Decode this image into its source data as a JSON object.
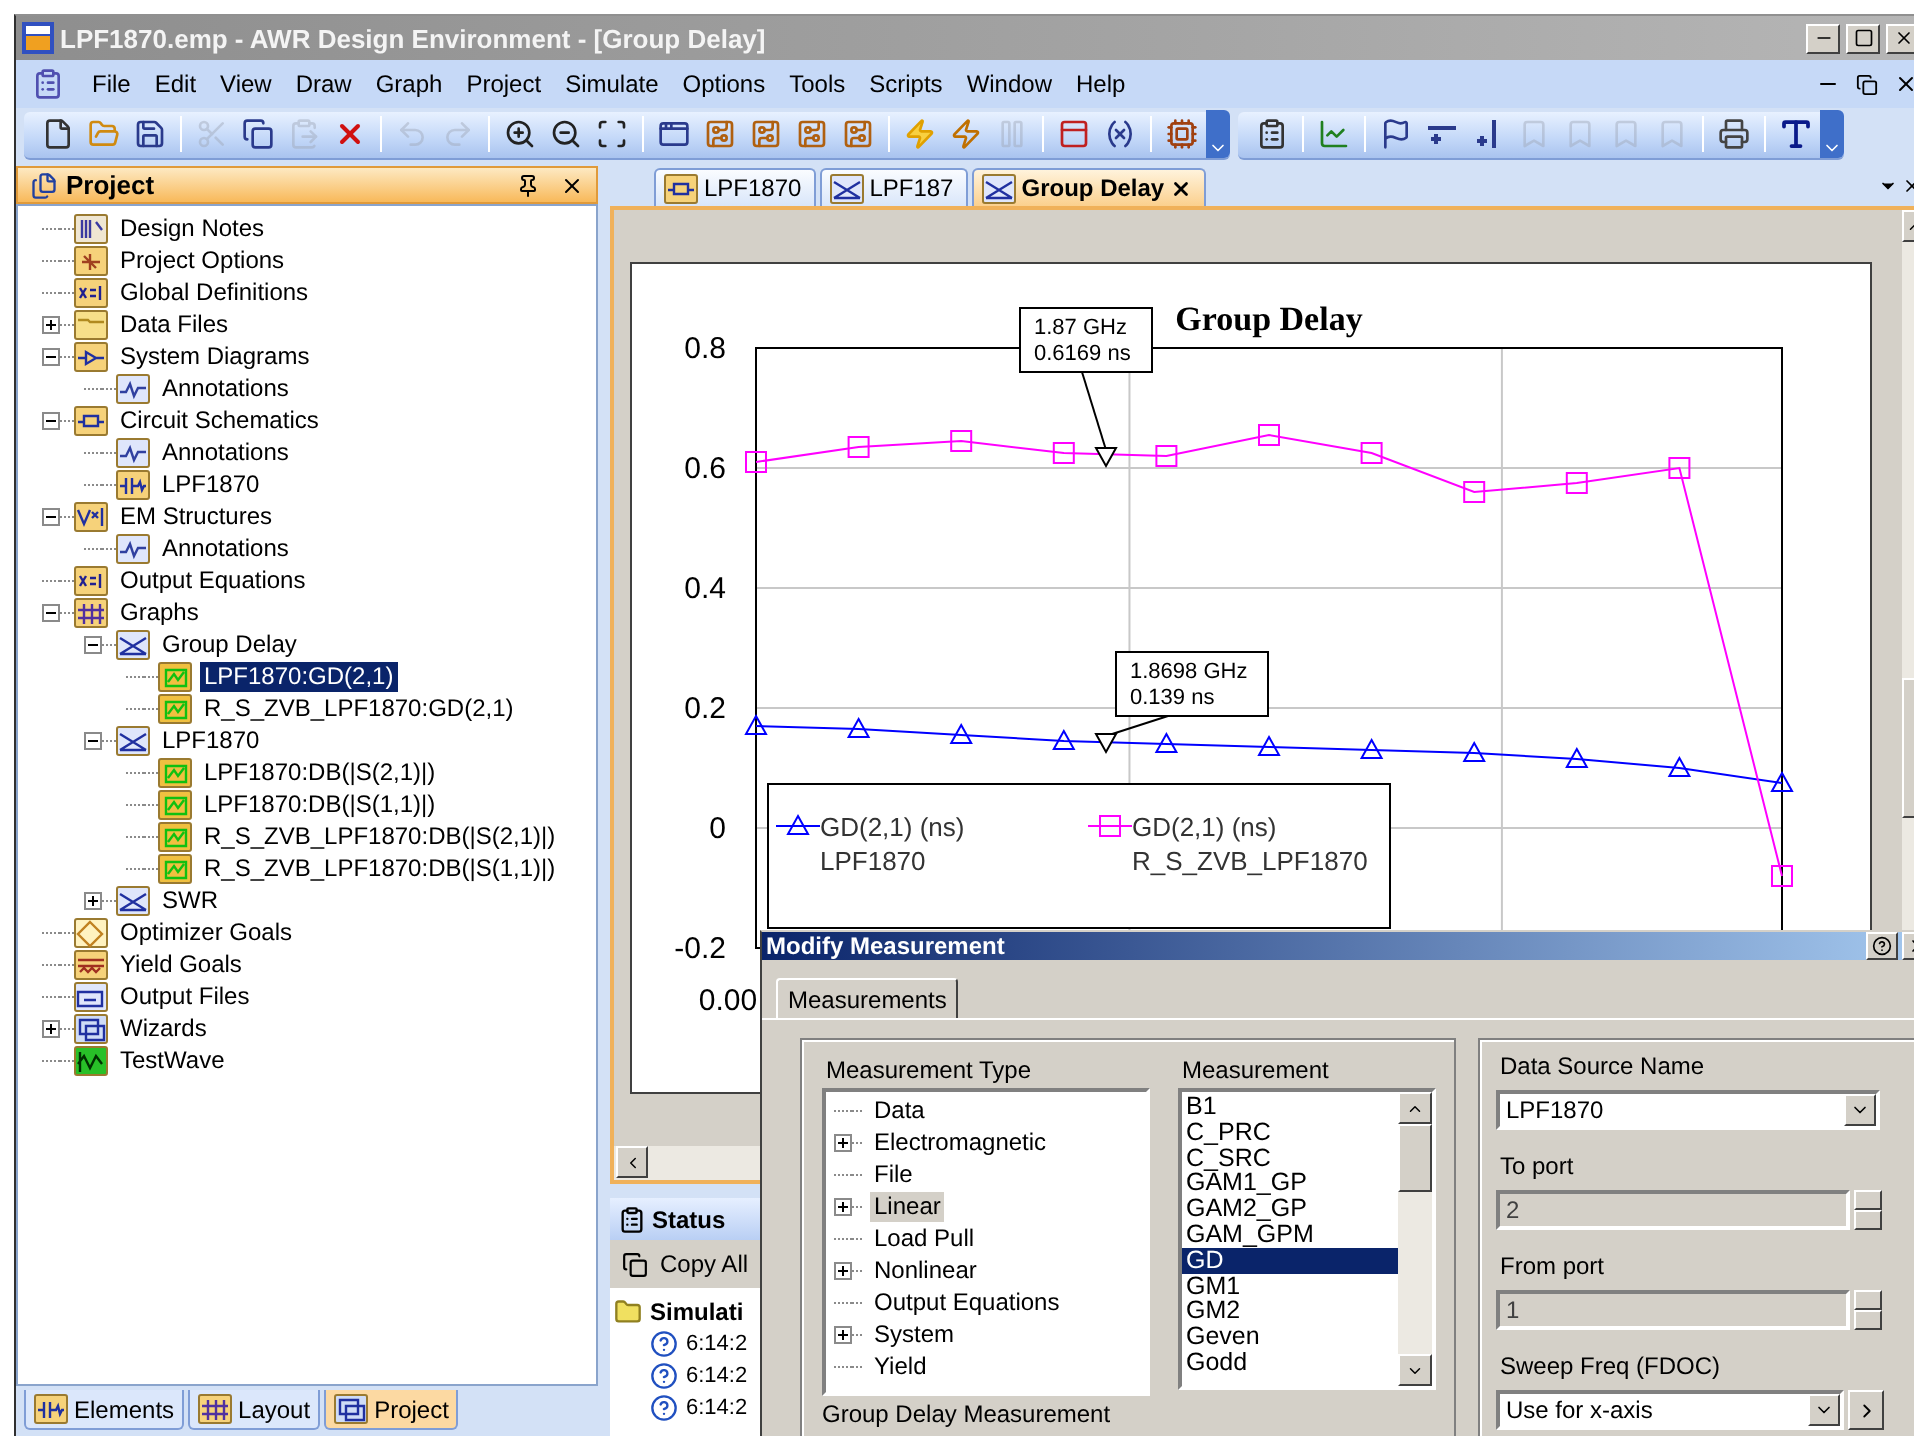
{
  "window": {
    "title": "LPF1870.emp - AWR Design Environment - [Group Delay]"
  },
  "menu": [
    "File",
    "Edit",
    "View",
    "Draw",
    "Graph",
    "Project",
    "Simulate",
    "Options",
    "Tools",
    "Scripts",
    "Window",
    "Help"
  ],
  "toolbars": [
    [
      {
        "kind": "new",
        "disabled": false
      },
      {
        "kind": "open",
        "disabled": false
      },
      {
        "kind": "save",
        "disabled": false
      },
      {
        "kind": "separator"
      },
      {
        "kind": "cut",
        "disabled": true
      },
      {
        "kind": "copy",
        "disabled": false
      },
      {
        "kind": "paste",
        "disabled": true
      },
      {
        "kind": "delete",
        "disabled": false
      },
      {
        "kind": "separator"
      },
      {
        "kind": "undo",
        "disabled": true
      },
      {
        "kind": "redo",
        "disabled": true
      },
      {
        "kind": "separator"
      },
      {
        "kind": "zoom-in",
        "disabled": false
      },
      {
        "kind": "zoom-out",
        "disabled": false
      },
      {
        "kind": "zoom-fit",
        "disabled": false
      },
      {
        "kind": "separator"
      },
      {
        "kind": "new-window",
        "disabled": false
      },
      {
        "kind": "board",
        "disabled": false
      },
      {
        "kind": "board",
        "disabled": false
      },
      {
        "kind": "board",
        "disabled": false
      },
      {
        "kind": "board",
        "disabled": false
      },
      {
        "kind": "separator"
      },
      {
        "kind": "lightning",
        "disabled": false
      },
      {
        "kind": "tune",
        "disabled": false
      },
      {
        "kind": "pause",
        "disabled": true
      },
      {
        "kind": "separator"
      },
      {
        "kind": "panel",
        "disabled": false
      },
      {
        "kind": "variable",
        "disabled": false
      },
      {
        "kind": "separator"
      },
      {
        "kind": "chip",
        "disabled": false
      },
      {
        "kind": "overflow"
      }
    ],
    [
      {
        "kind": "properties",
        "disabled": false
      },
      {
        "kind": "separator"
      },
      {
        "kind": "chart",
        "disabled": false
      },
      {
        "kind": "separator"
      },
      {
        "kind": "marker",
        "disabled": false
      },
      {
        "kind": "hline",
        "disabled": false
      },
      {
        "kind": "vline",
        "disabled": false
      },
      {
        "kind": "marker-max",
        "disabled": true
      },
      {
        "kind": "marker-min",
        "disabled": true
      },
      {
        "kind": "marker-query",
        "disabled": true
      },
      {
        "kind": "marker-ref",
        "disabled": true
      },
      {
        "kind": "separator"
      },
      {
        "kind": "printer",
        "disabled": false
      },
      {
        "kind": "separator"
      },
      {
        "kind": "text",
        "disabled": false
      },
      {
        "kind": "overflow"
      }
    ]
  ],
  "project_panel": {
    "title": "Project",
    "tree": [
      {
        "label": "Design Notes",
        "kind": "notes",
        "selected": false
      },
      {
        "label": "Project Options",
        "kind": "options",
        "selected": false
      },
      {
        "label": "Global Definitions",
        "kind": "definitions",
        "selected": false
      },
      {
        "label": "Data Files",
        "kind": "folder",
        "expanded": false,
        "selected": false
      },
      {
        "label": "System Diagrams",
        "kind": "diagram",
        "expanded": true,
        "selected": false,
        "children": [
          {
            "label": "Annotations",
            "kind": "annotation",
            "selected": false
          }
        ]
      },
      {
        "label": "Circuit Schematics",
        "kind": "schematic",
        "expanded": true,
        "selected": false,
        "children": [
          {
            "label": "Annotations",
            "kind": "annotation",
            "selected": false
          },
          {
            "label": "LPF1870",
            "kind": "circuit",
            "selected": false
          }
        ]
      },
      {
        "label": "EM Structures",
        "kind": "em",
        "expanded": true,
        "selected": false,
        "children": [
          {
            "label": "Annotations",
            "kind": "annotation",
            "selected": false
          }
        ]
      },
      {
        "label": "Output Equations",
        "kind": "definitions",
        "selected": false
      },
      {
        "label": "Graphs",
        "kind": "grid",
        "expanded": true,
        "selected": false,
        "children": [
          {
            "label": "Group Delay",
            "kind": "graph",
            "expanded": true,
            "selected": false,
            "children": [
              {
                "label": "LPF1870:GD(2,1)",
                "kind": "measurement",
                "selected": true
              },
              {
                "label": "R_S_ZVB_LPF1870:GD(2,1)",
                "kind": "measurement",
                "selected": false
              }
            ]
          },
          {
            "label": "LPF1870",
            "kind": "graph",
            "expanded": true,
            "selected": false,
            "children": [
              {
                "label": "LPF1870:DB(|S(2,1)|)",
                "kind": "measurement",
                "selected": false
              },
              {
                "label": "LPF1870:DB(|S(1,1)|)",
                "kind": "measurement",
                "selected": false
              },
              {
                "label": "R_S_ZVB_LPF1870:DB(|S(2,1)|)",
                "kind": "measurement",
                "selected": false
              },
              {
                "label": "R_S_ZVB_LPF1870:DB(|S(1,1)|)",
                "kind": "measurement",
                "selected": false
              }
            ]
          },
          {
            "label": "SWR",
            "kind": "graph",
            "expanded": false,
            "selected": false
          }
        ]
      },
      {
        "label": "Optimizer Goals",
        "kind": "goals",
        "selected": false
      },
      {
        "label": "Yield Goals",
        "kind": "yield",
        "selected": false
      },
      {
        "label": "Output Files",
        "kind": "output",
        "selected": false
      },
      {
        "label": "Wizards",
        "kind": "wizard",
        "expanded": false,
        "selected": false
      },
      {
        "label": "TestWave",
        "kind": "testwave",
        "selected": false
      }
    ],
    "tabs": [
      {
        "label": "Elements",
        "kind": "elements",
        "selected": false
      },
      {
        "label": "Layout",
        "kind": "layout",
        "selected": false
      },
      {
        "label": "Project",
        "kind": "project",
        "selected": true
      }
    ]
  },
  "document_tabs": [
    {
      "label": "LPF1870",
      "kind": "schematic",
      "selected": false
    },
    {
      "label": "LPF187",
      "kind": "graph",
      "selected": false
    },
    {
      "label": "Group Delay",
      "kind": "graph",
      "selected": true
    }
  ],
  "graph": {
    "x_axis_label": "0.00",
    "chart_data": {
      "type": "line",
      "title": "Group Delay",
      "ylim": [
        -0.2,
        0.8
      ],
      "grid": true,
      "legend": "lower left",
      "yticks": [
        {
          "value": 0.8,
          "label": "0.8"
        },
        {
          "value": 0.6,
          "label": "0.6"
        },
        {
          "value": 0.4,
          "label": "0.4"
        },
        {
          "value": 0.2,
          "label": "0.2"
        },
        {
          "value": 0,
          "label": "0"
        },
        {
          "value": -0.2,
          "label": "-0.2"
        }
      ],
      "series": [
        {
          "name": "GD(2,1) (ns)\nLPF1870",
          "color": "#0000ff",
          "marker": "triangle",
          "values": [
            0.17,
            0.165,
            0.155,
            0.145,
            0.14,
            0.135,
            0.13,
            0.125,
            0.115,
            0.1,
            0.075
          ]
        },
        {
          "name": "GD(2,1) (ns)\nR_S_ZVB_LPF1870",
          "color": "#ff00ff",
          "marker": "square",
          "values": [
            0.61,
            0.635,
            0.645,
            0.625,
            0.62,
            0.655,
            0.625,
            0.56,
            0.575,
            0.6,
            -0.08
          ]
        }
      ],
      "annotations": [
        "1.87 GHz\n0.6169 ns",
        "1.8698 GHz\n0.139 ns"
      ]
    }
  },
  "status_panel": {
    "title": "Status",
    "copy_button": "Copy All",
    "folder": "Simulati",
    "entries": [
      "6:14:2",
      "6:14:2",
      "6:14:2"
    ]
  },
  "dialog": {
    "title": "Modify Measurement",
    "tabs": [
      {
        "label": "Measurements",
        "selected": true
      }
    ],
    "measurement_type": {
      "label": "Measurement Type",
      "items": [
        {
          "label": "Data",
          "selected": false
        },
        {
          "label": "Electromagnetic",
          "expanded": false,
          "selected": false
        },
        {
          "label": "File",
          "selected": false
        },
        {
          "label": "Linear",
          "expanded": false,
          "selected": true
        },
        {
          "label": "Load Pull",
          "selected": false
        },
        {
          "label": "Nonlinear",
          "expanded": false,
          "selected": false
        },
        {
          "label": "Output Equations",
          "selected": false
        },
        {
          "label": "System",
          "expanded": false,
          "selected": false
        },
        {
          "label": "Yield",
          "selected": false
        }
      ]
    },
    "measurement": {
      "label": "Measurement",
      "items": [
        {
          "label": "B1",
          "selected": false
        },
        {
          "label": "C_PRC",
          "selected": false
        },
        {
          "label": "C_SRC",
          "selected": false
        },
        {
          "label": "GAM1_GP",
          "selected": false
        },
        {
          "label": "GAM2_GP",
          "selected": false
        },
        {
          "label": "GAM_GPM",
          "selected": false
        },
        {
          "label": "GD",
          "selected": true
        },
        {
          "label": "GM1",
          "selected": false
        },
        {
          "label": "GM2",
          "selected": false
        },
        {
          "label": "Geven",
          "selected": false
        },
        {
          "label": "Godd",
          "selected": false
        }
      ]
    },
    "description": "Group Delay Measurement",
    "fields": [
      {
        "kind": "combo",
        "label": "Data Source Name",
        "value": "LPF1870",
        "disabled": false
      },
      {
        "kind": "spin",
        "label": "To port",
        "value": "2",
        "disabled": true
      },
      {
        "kind": "spin",
        "label": "From port",
        "value": "1",
        "disabled": true
      },
      {
        "kind": "combo-button",
        "label": "Sweep Freq (FDOC)",
        "value": "Use for x-axis",
        "disabled": false
      }
    ]
  }
}
